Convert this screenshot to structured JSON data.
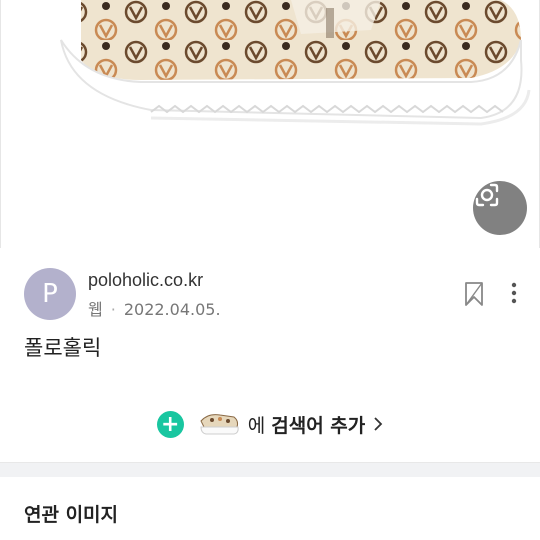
{
  "source": {
    "avatar_letter": "P",
    "site": "poloholic.co.kr",
    "type": "웹",
    "date": "2022.04.05."
  },
  "document": {
    "title": "폴로홀릭"
  },
  "search_add": {
    "text": "에",
    "bold_text": "검색어 추가"
  },
  "related": {
    "heading": "연관 이미지"
  },
  "icons": {
    "lens": "lens-search-icon",
    "bookmark": "bookmark-icon",
    "more": "more-vertical-icon",
    "add": "plus-icon",
    "chevron": "chevron-right-icon"
  },
  "colors": {
    "accent": "#19c6a0",
    "avatar": "#b3b1cc"
  }
}
